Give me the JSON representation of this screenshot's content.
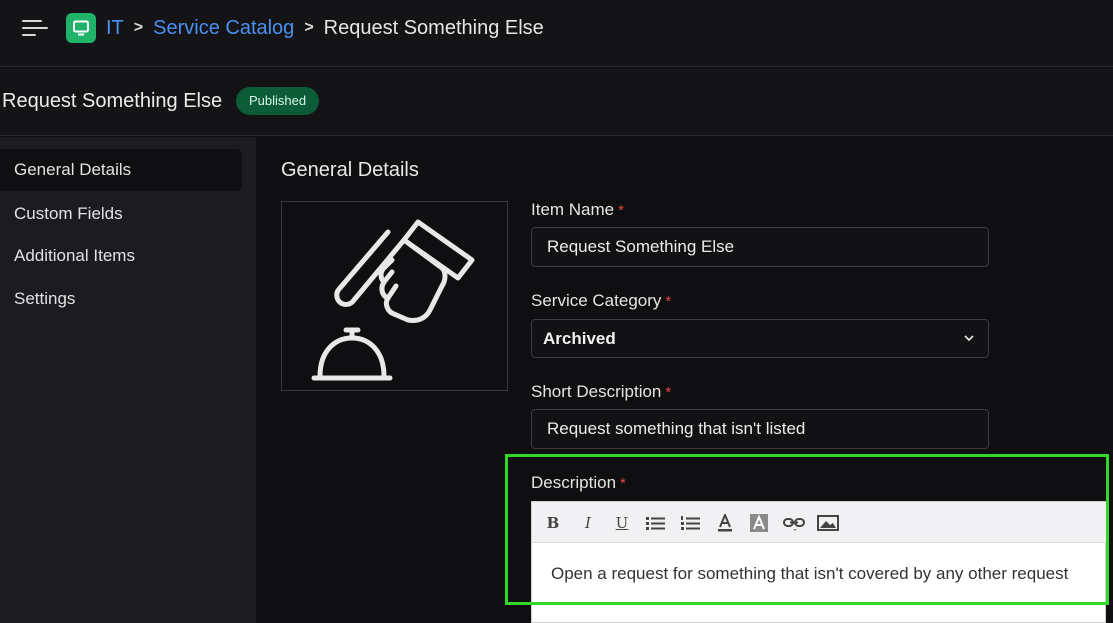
{
  "breadcrumb": {
    "items": [
      {
        "label": "IT"
      },
      {
        "label": "Service Catalog"
      }
    ],
    "separator": ">",
    "current": "Request Something Else"
  },
  "page": {
    "title": "Request Something Else",
    "status_badge": "Published"
  },
  "sidebar": {
    "items": [
      {
        "label": "General Details",
        "active": true
      },
      {
        "label": "Custom Fields",
        "active": false
      },
      {
        "label": "Additional Items",
        "active": false
      },
      {
        "label": "Settings",
        "active": false
      }
    ]
  },
  "main": {
    "section_title": "General Details",
    "image_icon": "hand-ringing-bell-icon",
    "required_marker": "*",
    "fields": {
      "item_name": {
        "label": "Item Name",
        "value": "Request Something Else"
      },
      "service_category": {
        "label": "Service Category",
        "value": "Archived"
      },
      "short_description": {
        "label": "Short Description",
        "value": "Request something that isn't listed"
      },
      "description": {
        "label": "Description",
        "value": "Open a request for something that isn't covered by any other request"
      }
    },
    "editor_toolbar": [
      "bold-icon",
      "italic-icon",
      "underline-icon",
      "bulleted-list-icon",
      "numbered-list-icon",
      "text-color-icon",
      "background-color-icon",
      "link-icon",
      "image-icon"
    ]
  },
  "colors": {
    "accent_link": "#4b8ff0",
    "badge_bg": "#0d5c38",
    "required": "#e04545",
    "highlight": "#35d62a",
    "app_icon": "#22b36a"
  }
}
